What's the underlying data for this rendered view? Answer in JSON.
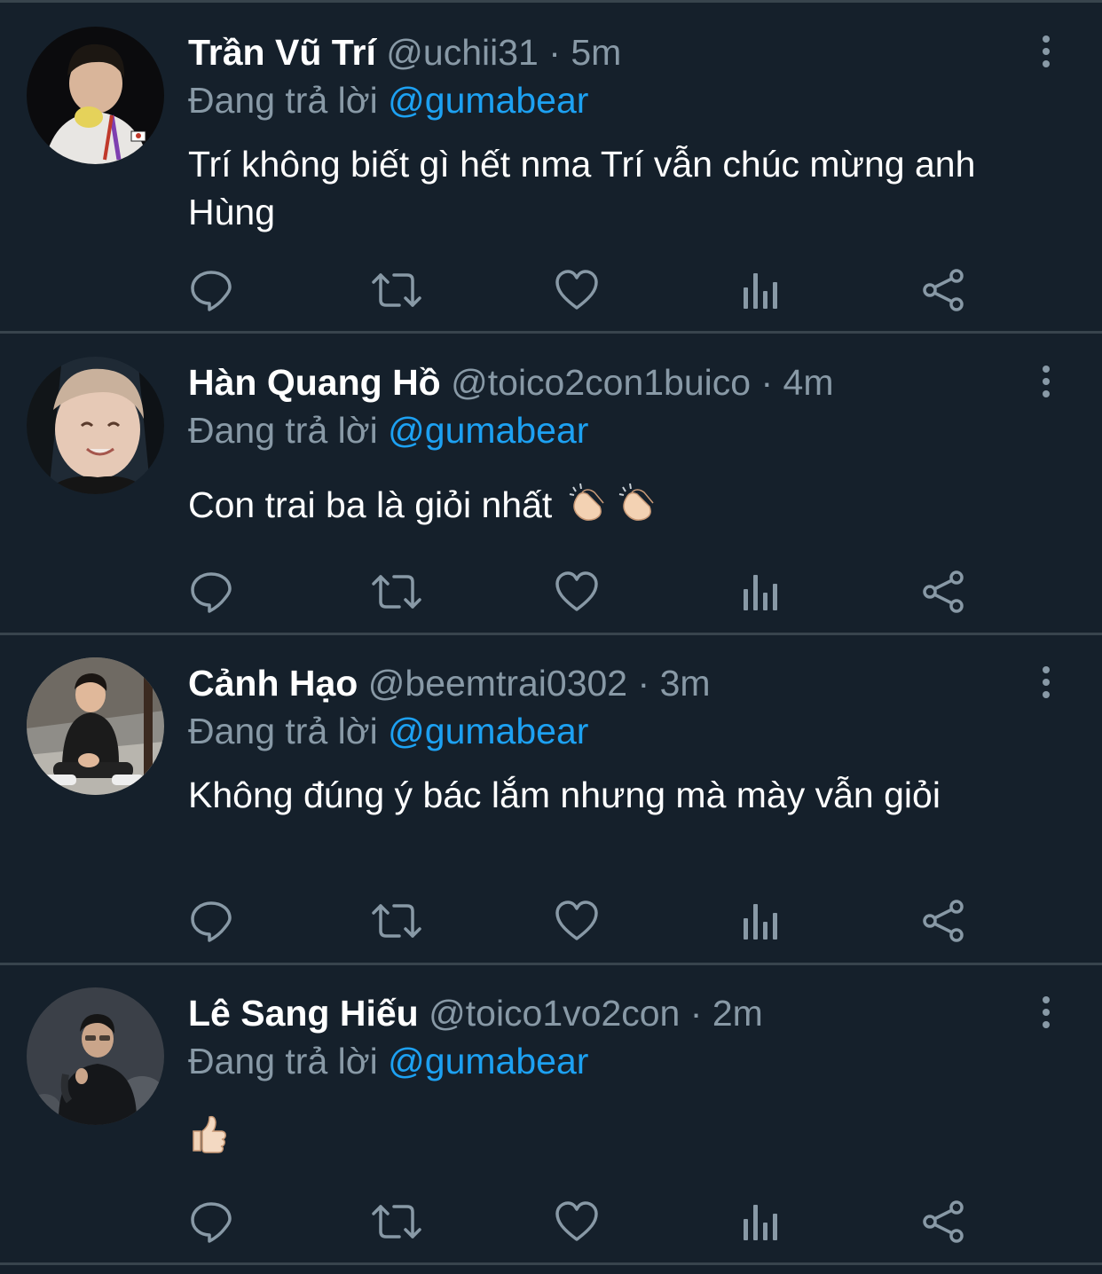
{
  "theme": {
    "background": "#15202b",
    "divider": "#38444d",
    "text": "#ffffff",
    "muted": "#8899a6",
    "accent": "#1da1f2"
  },
  "reply_prefix": "Đang trả lời",
  "action_icons": [
    "reply-icon",
    "retweet-icon",
    "like-icon",
    "analytics-icon",
    "share-icon"
  ],
  "tweets": [
    {
      "name": "Trần Vũ Trí",
      "handle": "@uchii31",
      "separator": "·",
      "time": "5m",
      "reply_to": "@gumabear",
      "text": "Trí không biết gì hết nma Trí vẫn chúc mừng anh Hùng",
      "emoji": ""
    },
    {
      "name": "Hàn Quang Hồ",
      "handle": "@toico2con1buico",
      "separator": "·",
      "time": "4m",
      "reply_to": "@gumabear",
      "text": "Con trai ba là giỏi nhất",
      "emoji": "clapping-hands-icon"
    },
    {
      "name": "Cảnh Hạo",
      "handle": "@beemtrai0302",
      "separator": "·",
      "time": "3m",
      "reply_to": "@gumabear",
      "text": "Không đúng ý bác lắm nhưng mà mày vẫn giỏi",
      "emoji": ""
    },
    {
      "name": "Lê Sang Hiếu",
      "handle": "@toico1vo2con",
      "separator": "·",
      "time": "2m",
      "reply_to": "@gumabear",
      "text": "",
      "emoji": "thumbs-up-icon"
    }
  ]
}
